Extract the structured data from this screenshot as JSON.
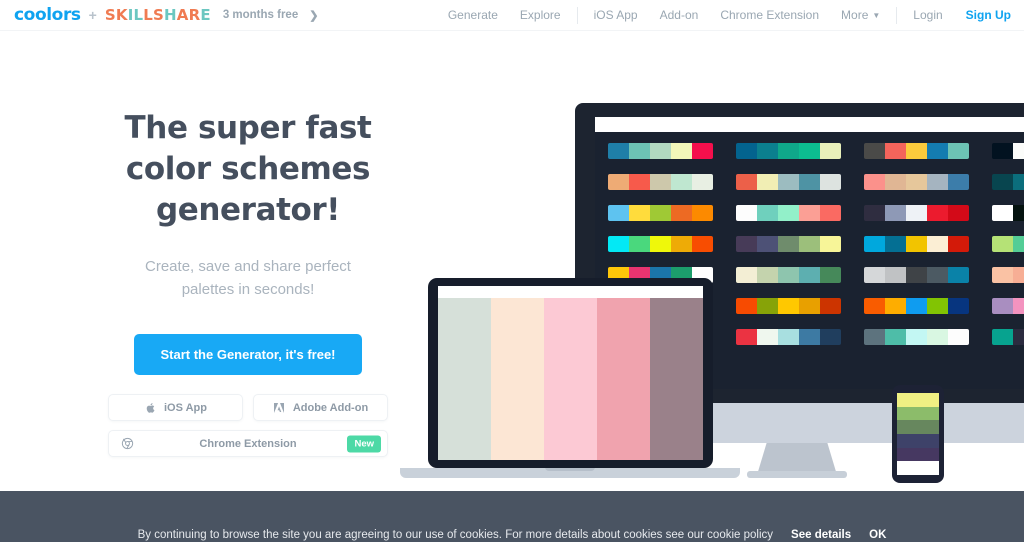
{
  "header": {
    "logo": "coolors",
    "plus": "+",
    "partner_letters": [
      {
        "c": "S",
        "color": "#f07b52"
      },
      {
        "c": "K",
        "color": "#f07b52"
      },
      {
        "c": "I",
        "color": "#6cc7c1"
      },
      {
        "c": "L",
        "color": "#6cc7c1"
      },
      {
        "c": "L",
        "color": "#f07b52"
      },
      {
        "c": "S",
        "color": "#f07b52"
      },
      {
        "c": "H",
        "color": "#6cc7c1"
      },
      {
        "c": "A",
        "color": "#f07b52"
      },
      {
        "c": "R",
        "color": "#f07b52"
      },
      {
        "c": "E",
        "color": "#6cc7c1"
      }
    ],
    "promo": "3 months free",
    "promo_arrow": "❯",
    "nav_primary": [
      {
        "label": "Generate"
      },
      {
        "label": "Explore"
      }
    ],
    "nav_secondary": [
      {
        "label": "iOS App"
      },
      {
        "label": "Add-on"
      },
      {
        "label": "Chrome Extension"
      }
    ],
    "more_label": "More",
    "more_caret": "▼",
    "login_label": "Login",
    "signup_label": "Sign Up",
    "accent_color": "#0fa3f0"
  },
  "hero": {
    "headline_line1": "The super fast",
    "headline_line2": "color schemes",
    "headline_line3": "generator!",
    "subhead_line1": "Create, save and share perfect",
    "subhead_line2": "palettes in seconds!",
    "cta_label": "Start the Generator, it's free!",
    "cta_color": "#18a9f5",
    "buttons": [
      {
        "label": "iOS App",
        "icon": "apple-icon"
      },
      {
        "label": "Adobe Add-on",
        "icon": "adobe-icon"
      },
      {
        "label": "Chrome Extension",
        "icon": "chrome-icon",
        "badge": "New",
        "badge_color": "#4dd9a6"
      }
    ]
  },
  "devices": {
    "monitor": {
      "bezel_color": "#1d2430",
      "screen_color": "#1a2230",
      "base_color": "#ccd3dd",
      "palettes": [
        [
          "#1f7fa8",
          "#6dc3b4",
          "#b2d9c0",
          "#f2f7b9",
          "#f50f4c"
        ],
        [
          "#03638e",
          "#0b7f8e",
          "#0fa88a",
          "#0cbd90",
          "#e9f0ba"
        ],
        [
          "#4a4a48",
          "#f4645b",
          "#fbcb3c",
          "#147cb0",
          "#6dc3b4"
        ],
        [
          "#021220",
          "#fbfcfa",
          "#22c0ac",
          "#e5171f",
          "#ffa400"
        ],
        [
          "#eeab75",
          "#f75a4b",
          "#cdc8ab",
          "#bfe7d0",
          "#e8efe3"
        ],
        [
          "#ec6049",
          "#f1eeb4",
          "#9cbcc0",
          "#4e93a4",
          "#dde3e0"
        ],
        [
          "#fb918b",
          "#e0b694",
          "#e6c79b",
          "#a5b4c0",
          "#3c7daa"
        ],
        [
          "#08454f",
          "#0b6e7c",
          "#d7f2dc",
          "#49699b",
          "#f4565c"
        ],
        [
          "#5ec3f0",
          "#ffdc3c",
          "#9fc935",
          "#ed6a23",
          "#fc8a00"
        ],
        [
          "#fdfdfd",
          "#6fd0bd",
          "#92f0c9",
          "#fb9f95",
          "#fa6a62"
        ],
        [
          "#2f2d40",
          "#8e99b6",
          "#eef2f6",
          "#ec1b2e",
          "#d30a18"
        ],
        [
          "#ffffff",
          "#04120f",
          "#044377",
          "#0679b2",
          "#0fa3e8"
        ],
        [
          "#03e9f5",
          "#4ad87d",
          "#eff80a",
          "#eeab06",
          "#f84d01"
        ],
        [
          "#473b58",
          "#4d5176",
          "#6f8c6c",
          "#9cbf7b",
          "#f7f598"
        ],
        [
          "#00a8dd",
          "#046f93",
          "#f2c400",
          "#fbeed4",
          "#d31a09"
        ],
        [
          "#b5e276",
          "#54cd96",
          "#2d85ae",
          "#4f5277",
          "#56405a"
        ],
        [
          "#ffc709",
          "#e83470",
          "#1b75aa",
          "#1c9e6c",
          "#ffffff"
        ],
        [
          "#f3eed4",
          "#c4d3ad",
          "#8ec5ae",
          "#5dafb0",
          "#46895a"
        ],
        [
          "#d5d7d9",
          "#c0c2c4",
          "#3f4347",
          "#4c5a63",
          "#0a82a8"
        ],
        [
          "#fac2a4",
          "#f7ae95",
          "#e09b9b",
          "#b98f95",
          "#6b6b72"
        ],
        [
          "#cfdada",
          "#fbe5dc",
          "#fbc8d4",
          "#f2a0ae",
          "#9b8189"
        ],
        [
          "#f74b01",
          "#87a308",
          "#ffc800",
          "#e8a000",
          "#cc3400"
        ],
        [
          "#f95c00",
          "#fead00",
          "#0f9cf0",
          "#82c403",
          "#07357f"
        ],
        [
          "#a98ec0",
          "#f393bf",
          "#edbedc",
          "#eee9ef",
          "#b8bedd"
        ],
        [
          "#cdf2d1",
          "#e0afef",
          "#fa86bd",
          "#ece0a2",
          "#aad8f7"
        ],
        [
          "#eb3342",
          "#eff7ee",
          "#a8dfe0",
          "#3d7aa3",
          "#203e5e"
        ],
        [
          "#5d737e",
          "#4ebda8",
          "#c3f7f3",
          "#d9f7e2",
          "#fdfdfd"
        ],
        [
          "#07a38f",
          "#2b2b3f",
          "#fafc7c",
          "#fb9b5f",
          "#f04a54"
        ],
        [
          "#6c2c3c",
          "#e0ad94",
          "#f5e8dd",
          "#13040f",
          "#eb4052"
        ]
      ]
    },
    "laptop": {
      "shell_color": "#161d2b",
      "palette": [
        "#d6e0d9",
        "#fce6d4",
        "#fcc9d4",
        "#f0a3ae",
        "#9a818a"
      ]
    },
    "phone": {
      "shell_color": "#1d2235",
      "palette": [
        "#f0f083",
        "#8cbc6a",
        "#67875e",
        "#3e4269",
        "#463861",
        "#ffffff"
      ]
    }
  },
  "cookie_bar": {
    "message": "By continuing to browse the site you are agreeing to our use of cookies. For more details about cookies see our cookie policy",
    "details_label": "See details",
    "ok_label": "OK",
    "background": "#4a5462"
  }
}
